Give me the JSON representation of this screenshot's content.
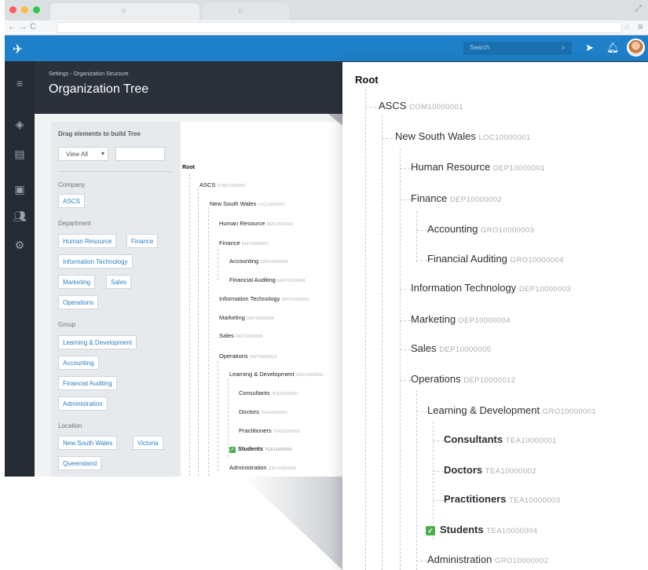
{
  "header": {
    "search_placeholder": "Search"
  },
  "page": {
    "breadcrumb": "Settings - Organization Structure",
    "title": "Organization Tree"
  },
  "panel": {
    "title": "Drag elements to build Tree",
    "view_select": "View All",
    "sections": {
      "company": "Company",
      "department": "Department",
      "group": "Group",
      "location": "Location"
    },
    "company_chips": [
      "ASCS"
    ],
    "department_chips": [
      "Human Resource",
      "Finance",
      "Information Technology",
      "Marketing",
      "Sales",
      "Operations"
    ],
    "group_chips": [
      "Learning & Development",
      "Accounting",
      "Financial Auditing",
      "Administration"
    ],
    "location_chips": [
      "New South Wales",
      "Victoria",
      "Queensland"
    ]
  },
  "tree": {
    "root": "Root",
    "nodes": [
      {
        "name": "ASCS",
        "code": "COM10000001"
      },
      {
        "name": "New South Wales",
        "code": "LOC10000001"
      },
      {
        "name": "Human Resource",
        "code": "DEP10000001"
      },
      {
        "name": "Finance",
        "code": "DEP10000002"
      },
      {
        "name": "Accounting",
        "code": "GRO10000003"
      },
      {
        "name": "Financial Auditing",
        "code": "GRO10000004"
      },
      {
        "name": "Information Technology",
        "code": "DEP10000003"
      },
      {
        "name": "Marketing",
        "code": "DEP10000004"
      },
      {
        "name": "Sales",
        "code": "DEP10000005"
      },
      {
        "name": "Operations",
        "code": "DEP10000012"
      },
      {
        "name": "Learning & Development",
        "code": "GRO10000001"
      },
      {
        "name": "Consultants",
        "code": "TEA10000001"
      },
      {
        "name": "Doctors",
        "code": "TEA10000002"
      },
      {
        "name": "Practitioners",
        "code": "TEA10000003"
      },
      {
        "name": "Students",
        "code": "TEA10000004"
      },
      {
        "name": "Administration",
        "code": "GRO10000002"
      }
    ]
  },
  "colors": {
    "header_blue": "#1e80c9",
    "rail_dark": "#262b33",
    "chip_text": "#2d7fbe",
    "check_green": "#4cae4f"
  }
}
